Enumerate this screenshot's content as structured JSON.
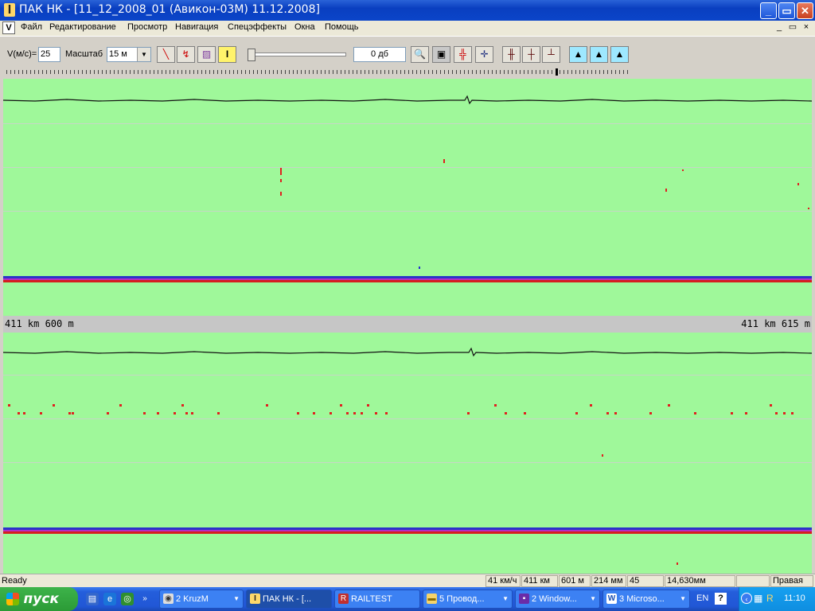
{
  "window": {
    "title": "ПАК НК - [11_12_2008_01  (Авикон-03М) 11.12.2008]",
    "app_icon": "I",
    "min_label": "_",
    "max_label": "▭",
    "close_label": "✕"
  },
  "menu": {
    "doc_icon": "V",
    "items": [
      "Файл",
      "Редактирование",
      "Просмотр",
      "Навигация",
      "Спецэффекты",
      "Окна",
      "Помощь"
    ],
    "mdi_min": "_",
    "mdi_restore": "▭",
    "mdi_close": "×"
  },
  "toolbar": {
    "speed_label": "V(м/с)=",
    "speed_value": "25",
    "scale_label": "Масштаб",
    "scale_value": "15 м",
    "gain_value": "0 дб"
  },
  "tracks": {
    "km_left": "411 km 600 m",
    "km_right": "411 km 615 m"
  },
  "status": {
    "ready": "Ready",
    "speed": "41 км/ч",
    "km": "411 км",
    "m": "601 м",
    "mm": "214 мм",
    "num": "45",
    "coord": "14,630мм",
    "empty": "",
    "side": "Правая"
  },
  "taskbar": {
    "start": "пуск",
    "items": [
      {
        "label": "2 KruzM"
      },
      {
        "label": "ПАК НК - [..."
      },
      {
        "label": "RAILTEST"
      },
      {
        "label": "5 Провод..."
      },
      {
        "label": "2 Window..."
      },
      {
        "label": "3 Microso..."
      }
    ],
    "lang": "EN",
    "clock": "11:10"
  },
  "colors": {
    "track_bg": "#9ff89a",
    "defect": "#e02020",
    "rail_blue": "#2b34c9",
    "rail_red": "#d61e1e"
  }
}
